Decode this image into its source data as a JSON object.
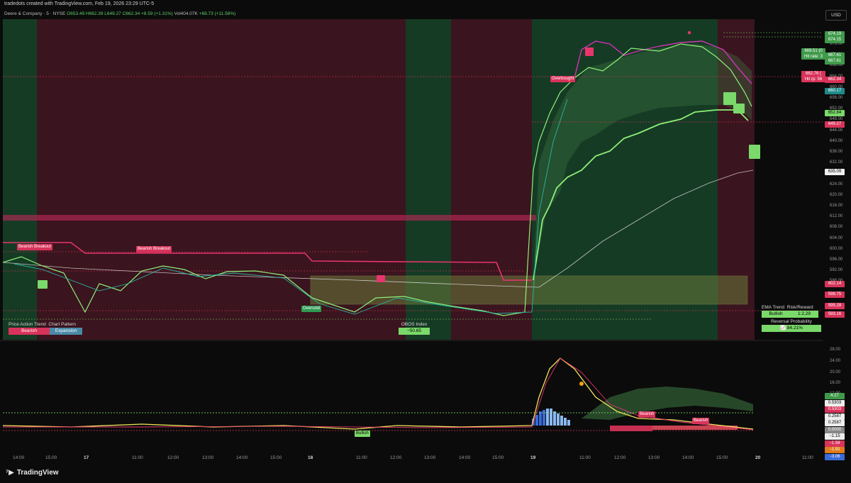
{
  "header": {
    "created_text": "tradedots created with TradingView.com, Feb 19, 2026 23:29 UTC-5",
    "symbol_line": "Deere & Company · 5 · NYSE",
    "open": "O653.49",
    "high": "H662.39",
    "low": "L649.27",
    "close": "C662.34",
    "change": "+8.59 (+1.31%)",
    "volume": "Vol404.07K",
    "vol_change": "+68.73 (+11.58%)",
    "currency_button": "USD"
  },
  "price_axis": [
    "676.00",
    "672.00",
    "668.00",
    "664.00",
    "660.00",
    "656.00",
    "652.00",
    "648.00",
    "644.00",
    "640.00",
    "636.00",
    "632.00",
    "628.00",
    "624.00",
    "620.00",
    "616.00",
    "612.00",
    "608.00",
    "604.00",
    "600.00",
    "596.00",
    "592.00",
    "588.00"
  ],
  "price_tags": [
    {
      "text": "674.19",
      "color": "#3f9a4a"
    },
    {
      "text": "674.15",
      "color": "#3f9a4a"
    },
    {
      "text": "667.61",
      "color": "#3f9a4a"
    },
    {
      "text": "667.61",
      "color": "#3f9a4a"
    },
    {
      "text": "662.34",
      "color": "#d8335a"
    },
    {
      "text": "660.17",
      "color": "#1f8a8a"
    },
    {
      "text": "652.84",
      "color": "#7ad96a"
    },
    {
      "text": "649.27",
      "color": "#d8335a"
    },
    {
      "text": "635.09",
      "color": "#eeeeee"
    },
    {
      "text": "602.14",
      "color": "#d8335a"
    },
    {
      "text": "598.75",
      "color": "#d8335a"
    },
    {
      "text": "595.28",
      "color": "#d8335a"
    },
    {
      "text": "593.16",
      "color": "#d8335a"
    }
  ],
  "osc_axis": [
    "28.00",
    "24.00",
    "20.00",
    "16.00",
    "12.00"
  ],
  "osc_tags": [
    {
      "text": "4.27",
      "color": "#3f9a4a"
    },
    {
      "text": "0.5303",
      "color": "#eeeeee"
    },
    {
      "text": "0.5303",
      "color": "#d8335a"
    },
    {
      "text": "0.2587",
      "color": "#eeeeee"
    },
    {
      "text": "0.2587",
      "color": "#eeeeee"
    },
    {
      "text": "0.0000",
      "color": "#888888"
    },
    {
      "text": "−1.15",
      "color": "#eeeeee"
    },
    {
      "text": "−1.58",
      "color": "#d8335a"
    },
    {
      "text": "−1.91",
      "color": "#e07a1a"
    },
    {
      "text": "−3.06",
      "color": "#3a6bd8"
    }
  ],
  "time_axis": [
    "14:00",
    "15:00",
    "17",
    "11:00",
    "12:00",
    "13:00",
    "14:00",
    "15:00",
    "18",
    "11:00",
    "12:00",
    "13:00",
    "14:00",
    "15:00",
    "19",
    "11:00",
    "12:00",
    "13:00",
    "14:00",
    "15:00",
    "20",
    "11:00"
  ],
  "annotations": {
    "bearish_breakout": "Bearish Breakout",
    "bearish_breakout2": "Bearish Breakout",
    "overbought": "Overbought",
    "oversold": "Oversold",
    "bullish_osc": "Bullish",
    "bearish_osc1": "Bearish",
    "bearish_osc2": "Bearish",
    "hit_rate_top": "669.51 (0",
    "hit_rate_top2": "Hit rate: 3",
    "hit_rate_bot": "662.76 (",
    "hit_rate_bot2": "Hit rp: 56",
    "overbought_tag": "Overbought"
  },
  "tables": {
    "price_action_trend_label": "Price Action Trend",
    "chart_pattern_label": "Chart Pattern",
    "price_action_trend_value": "Bearish",
    "chart_pattern_value": "Expansion",
    "obos_label": "OBOS Index",
    "obos_value": "−50.65",
    "ema_trend_label": "EMA Trend",
    "risk_reward_label": "Risk/Reward",
    "ema_trend_value": "Bullish",
    "risk_reward_value": "1:2.29",
    "reversal_label": "Reversal Probability",
    "reversal_value": "📈 84.21%"
  },
  "colors": {
    "bull_bg": "#163b24",
    "bear_bg": "#3a141e",
    "bull_candle": "#7ad96a",
    "bear_candle": "#d8335a",
    "accent_pink": "#e8356e",
    "accent_green": "#8ef07a"
  },
  "footer": {
    "brand": "TradingView"
  }
}
